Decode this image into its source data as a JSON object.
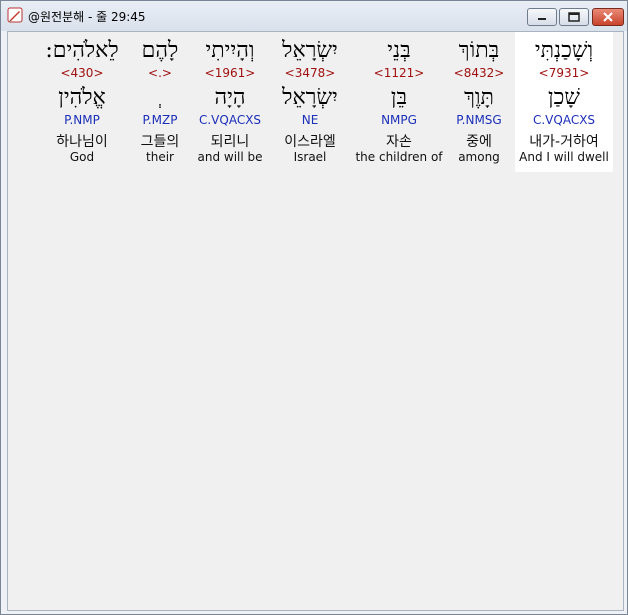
{
  "window": {
    "title": "@원전분해 - 줄 29:45",
    "colors": {
      "strong": "#a01010",
      "morph": "#1c2fb8",
      "selected_bg": "#ffffff"
    }
  },
  "words": [
    {
      "hebrew": "וְשָׁכַנְתִּי",
      "strong": "<7931>",
      "root": "שָׁכַן",
      "morph": "C.VQACXS",
      "korean": "내가-거하여",
      "english": "And I will dwell",
      "selected": true
    },
    {
      "hebrew": "בְּתוֹךְ",
      "strong": "<8432>",
      "root": "תָּוֶךְ",
      "morph": "P.NMSG",
      "korean": "중에",
      "english": "among",
      "selected": false
    },
    {
      "hebrew": "בְּנֵי",
      "strong": "<1121>",
      "root": "בֵּן",
      "morph": "NMPG",
      "korean": "자손",
      "english": "the children of",
      "selected": false
    },
    {
      "hebrew": "יִשְׂרָאֵל",
      "strong": "<3478>",
      "root": "יִשְׂרָאֵל",
      "morph": "NE",
      "korean": "이스라엘",
      "english": "Israel",
      "selected": false
    },
    {
      "hebrew": "וְהָיִיתִי",
      "strong": "<1961>",
      "root": "הָיָה",
      "morph": "C.VQACXS",
      "korean": "되리니",
      "english": "and will be",
      "selected": false
    },
    {
      "hebrew": "לָהֶם",
      "strong": "<.>",
      "root": "ְ",
      "morph": "P.MZP",
      "korean": "그들의",
      "english": "their",
      "selected": false
    },
    {
      "hebrew": "לֵאלֹהִים:",
      "strong": "<430>",
      "root": "אֱלֹהִין",
      "morph": "P.NMP",
      "korean": "하나님이",
      "english": "God",
      "selected": false
    }
  ]
}
